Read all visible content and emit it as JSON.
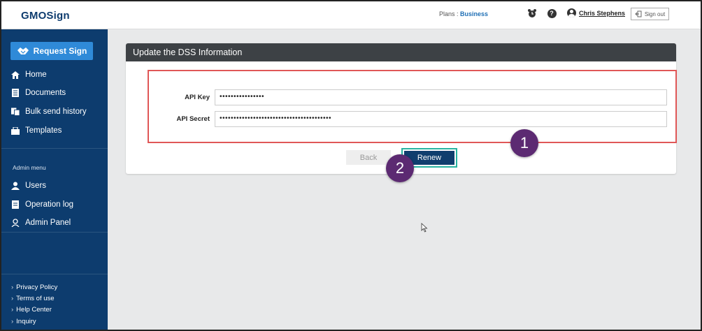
{
  "header": {
    "logo": "GMOSign",
    "plans_label": "Plans :",
    "plans_value": "Business",
    "user_name": "Chris Stephens",
    "signout_label": "Sign out",
    "icons": {
      "alarm": "alarm-clock-icon",
      "help": "help-icon",
      "user": "user-icon",
      "signout": "sign-out-icon"
    }
  },
  "sidebar": {
    "request_button": "Request Sign",
    "items": [
      {
        "label": "Home",
        "icon": "home-icon"
      },
      {
        "label": "Documents",
        "icon": "documents-icon"
      },
      {
        "label": "Bulk send history",
        "icon": "bulk-send-icon"
      },
      {
        "label": "Templates",
        "icon": "templates-icon"
      }
    ],
    "admin_title": "Admin menu",
    "admin_items": [
      {
        "label": "Users",
        "icon": "users-icon"
      },
      {
        "label": "Operation log",
        "icon": "log-icon"
      },
      {
        "label": "Admin Panel",
        "icon": "admin-panel-icon"
      }
    ],
    "footer_links": [
      "Privacy Policy",
      "Terms of use",
      "Help Center",
      "Inquiry"
    ]
  },
  "panel": {
    "title": "Update the DSS Information",
    "api_key_label": "API Key",
    "api_key_value": "••••••••••••••••",
    "api_secret_label": "API Secret",
    "api_secret_value": "••••••••••••••••••••••••••••••••••••••••",
    "back_label": "Back",
    "renew_label": "Renew"
  },
  "annotations": {
    "badge1": "1",
    "badge2": "2"
  },
  "colors": {
    "sidebar": "#0d3c6e",
    "accent": "#2f8ad8",
    "highlight": "#e05757",
    "badge": "#5c2a72",
    "renew_outline": "#27b3a0"
  }
}
